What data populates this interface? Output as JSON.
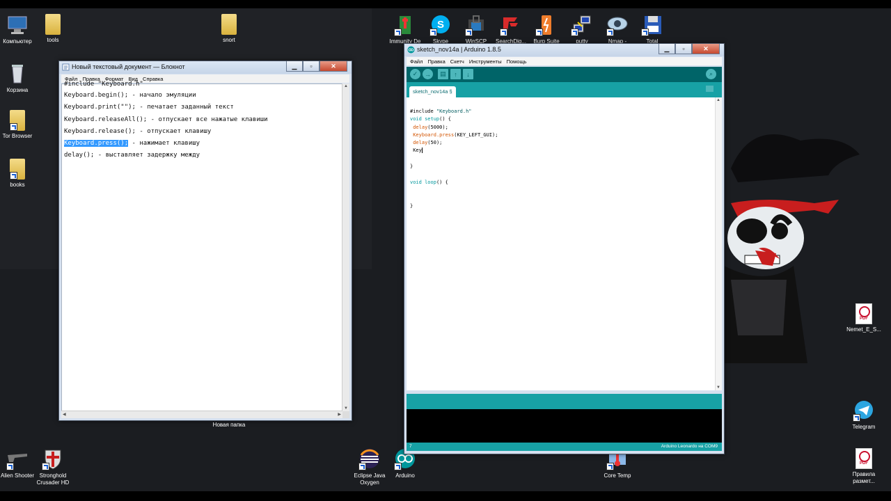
{
  "desktop_icons": {
    "computer": "Компьютер",
    "tools": "tools",
    "snort": "snort",
    "recycle": "Корзина",
    "tor": "Tor Browser",
    "books": "books",
    "immunity": "Immunity De",
    "skype": "Skype",
    "winscp": "WinSCP",
    "searchdiggity": "SearchDiq...",
    "burp": "Burp Suite",
    "putty": "putty",
    "nmap": "Nmap -",
    "total": "Total",
    "new_folder": "Новая папка",
    "pdf1": "Nemet_E_S...",
    "telegram": "Telegram",
    "pdf2": "Правила размет...",
    "alien": "Alien Shooter",
    "stronghold": "Stronghold Crusader HD",
    "eclipse": "Eclipse Java Oxygen",
    "arduino": "Arduino",
    "coretemp": "Core Temp"
  },
  "notepad": {
    "title": "Новый текстовый документ — Блокнот",
    "menu": [
      "Файл",
      "Правка",
      "Формат",
      "Вид",
      "Справка"
    ],
    "lines": [
      "#include \"Keyboard.h\"",
      "Keyboard.begin(); - начало эмуляции",
      "Keyboard.print(\"\"); - печатает заданный текст",
      "Keyboard.releaseAll(); - отпускает все нажатые клавиши",
      "Keyboard.release(); - отпускает клавишу",
      "",
      "delay(); - выставляет задержку между"
    ],
    "selected_text": "Keyboard.press();",
    "selected_rest": " - нажимает клавишу"
  },
  "arduino": {
    "title": "sketch_nov14a | Arduino 1.8.5",
    "menu": [
      "Файл",
      "Правка",
      "Скетч",
      "Инструменты",
      "Помощь"
    ],
    "tab": "sketch_nov14a §",
    "line_number": "7",
    "board": "Arduino Leonardo на COM9",
    "code": {
      "l1a": "#include ",
      "l1b": "\"Keyboard.h\"",
      "l2a": "void",
      "l2b": " setup",
      "l2c": "() {",
      "l3a": "delay",
      "l3b": "(5000);",
      "l4a": "Keyboard",
      "l4b": ".press",
      "l4c": "(KEY_LEFT_GUI);",
      "l5a": "delay",
      "l5b": "(50);",
      "l6": "Key",
      "l8": "}",
      "l10a": "void",
      "l10b": " loop",
      "l10c": "() {",
      "l13": "}"
    }
  },
  "colors": {
    "arduino_teal": "#00979c",
    "arduino_dark": "#006468",
    "selection": "#3399ff"
  }
}
